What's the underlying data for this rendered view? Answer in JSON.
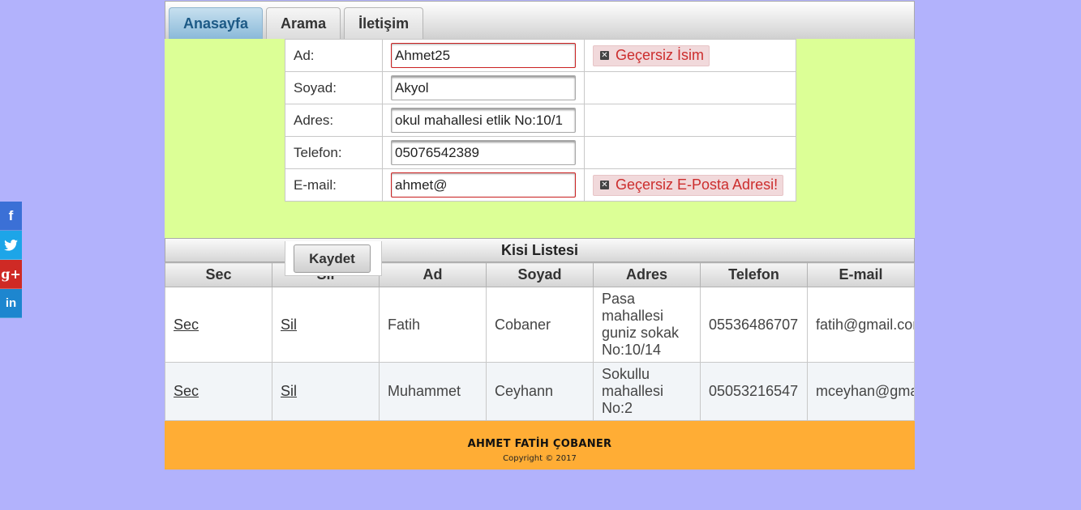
{
  "social": [
    {
      "label": "f",
      "icon": "facebook-icon"
    },
    {
      "label": "🐦",
      "icon": "twitter-icon"
    },
    {
      "label": "g+",
      "icon": "google-plus-icon"
    },
    {
      "label": "in",
      "icon": "linkedin-icon"
    }
  ],
  "tabs": [
    "Anasayfa",
    "Arama",
    "İletişim"
  ],
  "form": {
    "name_label": "Ad:",
    "name_value": "Ahmet25",
    "name_error": "Geçersiz İsim",
    "surname_label": "Soyad:",
    "surname_value": "Akyol",
    "address_label": "Adres:",
    "address_value": "okul mahallesi etlik No:10/1",
    "phone_label": "Telefon:",
    "phone_value": "05076542389",
    "email_label": "E-mail:",
    "email_value": "ahmet@",
    "email_error": "Geçersiz E-Posta Adresi!",
    "save_label": "Kaydet"
  },
  "list": {
    "title": "Kisi Listesi",
    "columns": [
      "Sec",
      "Sil",
      "Ad",
      "Soyad",
      "Adres",
      "Telefon",
      "E-mail"
    ],
    "rows": [
      {
        "sec": "Sec",
        "sil": "Sil",
        "ad": "Fatih",
        "soyad": "Cobaner",
        "adres": "Pasa mahallesi guniz sokak No:10/14",
        "telefon": "05536486707",
        "email": "fatih@gmail.com"
      },
      {
        "sec": "Sec",
        "sil": "Sil",
        "ad": "Muhammet",
        "soyad": "Ceyhann",
        "adres": "Sokullu mahallesi No:2",
        "telefon": "05053216547",
        "email": "mceyhan@gmail.com"
      }
    ]
  },
  "footer": {
    "name": "AHMET FATİH ÇOBANER",
    "copyright": "Copyright © 2017"
  },
  "colors": {
    "background": "#b2b2fc",
    "form_area": "#dcff96",
    "footer": "#ffad35",
    "error_text": "#cc2d2d"
  }
}
